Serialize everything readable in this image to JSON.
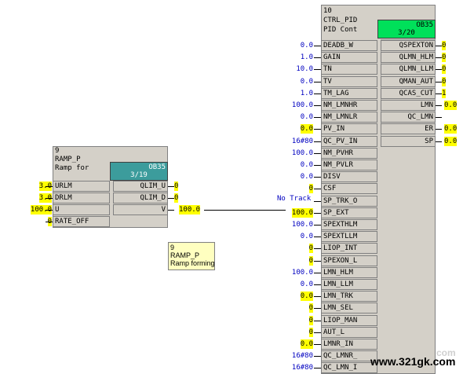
{
  "ramp": {
    "num": "9",
    "name": "RAMP_P",
    "desc": "Ramp for",
    "ob": "OB35",
    "ob_sub": "3/19",
    "inputs": [
      {
        "label": "URLM",
        "value": "3.0",
        "hl": true
      },
      {
        "label": "DRLM",
        "value": "3.0",
        "hl": true
      },
      {
        "label": "U",
        "value": "100.0",
        "hl": true
      },
      {
        "label": "RATE_OFF",
        "value": "0",
        "hl": true
      }
    ],
    "outputs": [
      {
        "label": "QLIM_U",
        "value": "0",
        "hl": true
      },
      {
        "label": "QLIM_D",
        "value": "0",
        "hl": true
      },
      {
        "label": "V",
        "value": "100.0",
        "hl": true
      }
    ]
  },
  "note": {
    "line1": "9",
    "line2": "RAMP_P",
    "line3": "Ramp forming"
  },
  "wire_label": "No Track",
  "pid": {
    "num": "10",
    "name": "CTRL_PID",
    "desc": "PID Cont",
    "ob": "OB35",
    "ob_sub": "3/20",
    "inputs": [
      {
        "label": "DEADB_W",
        "value": "0.0",
        "hl": false
      },
      {
        "label": "GAIN",
        "value": "1.0",
        "hl": false
      },
      {
        "label": "TN",
        "value": "10.0",
        "hl": false
      },
      {
        "label": "TV",
        "value": "0.0",
        "hl": false
      },
      {
        "label": "TM_LAG",
        "value": "1.0",
        "hl": false
      },
      {
        "label": "NM_LMNHR",
        "value": "100.0",
        "hl": false
      },
      {
        "label": "NM_LMNLR",
        "value": "0.0",
        "hl": false
      },
      {
        "label": "PV_IN",
        "value": "0.0",
        "hl": true
      },
      {
        "label": "QC_PV_IN",
        "value": "16#80",
        "hl": false
      },
      {
        "label": "NM_PVHR",
        "value": "100.0",
        "hl": false
      },
      {
        "label": "NM_PVLR",
        "value": "0.0",
        "hl": false
      },
      {
        "label": "DISV",
        "value": "0.0",
        "hl": false
      },
      {
        "label": "CSF",
        "value": "0",
        "hl": true
      },
      {
        "label": "SP_TRK_O",
        "value": "No Track",
        "hl": false
      },
      {
        "label": "SP_EXT",
        "value": "100.0",
        "hl": true
      },
      {
        "label": "SPEXTHLM",
        "value": "100.0",
        "hl": false
      },
      {
        "label": "SPEXTLLM",
        "value": "0.0",
        "hl": false
      },
      {
        "label": "LIOP_INT",
        "value": "0",
        "hl": true
      },
      {
        "label": "SPEXON_L",
        "value": "0",
        "hl": true
      },
      {
        "label": "LMN_HLM",
        "value": "100.0",
        "hl": false
      },
      {
        "label": "LMN_LLM",
        "value": "0.0",
        "hl": false
      },
      {
        "label": "LMN_TRK",
        "value": "0.0",
        "hl": true
      },
      {
        "label": "LMN_SEL",
        "value": "0",
        "hl": true
      },
      {
        "label": "LIOP_MAN",
        "value": "0",
        "hl": true
      },
      {
        "label": "AUT_L",
        "value": "0",
        "hl": true
      },
      {
        "label": "LMNR_IN",
        "value": "0.0",
        "hl": true
      },
      {
        "label": "QC_LMNR_",
        "value": "16#80",
        "hl": false
      },
      {
        "label": "QC_LMN_I",
        "value": "16#80",
        "hl": false
      }
    ],
    "outputs": [
      {
        "label": "QSPEXTON",
        "value": "0",
        "hl": true
      },
      {
        "label": "QLMN_HLM",
        "value": "0",
        "hl": true
      },
      {
        "label": "QLMN_LLM",
        "value": "0",
        "hl": true
      },
      {
        "label": "QMAN_AUT",
        "value": "0",
        "hl": true
      },
      {
        "label": "QCAS_CUT",
        "value": "1",
        "hl": true
      },
      {
        "label": "LMN",
        "value": "0.0",
        "hl": true
      },
      {
        "label": "QC_LMN",
        "value": "",
        "hl": false
      },
      {
        "label": "ER",
        "value": "0.0",
        "hl": true
      },
      {
        "label": "SP",
        "value": "0.0",
        "hl": true
      }
    ]
  },
  "watermark": {
    "site": "www.321gk.com",
    "ghost": "com"
  },
  "colors": {
    "ob_ramp": "#3c9c9c",
    "ob_pid": "#00e05a",
    "highlight": "#ffff00",
    "block": "#d4d0c8"
  }
}
